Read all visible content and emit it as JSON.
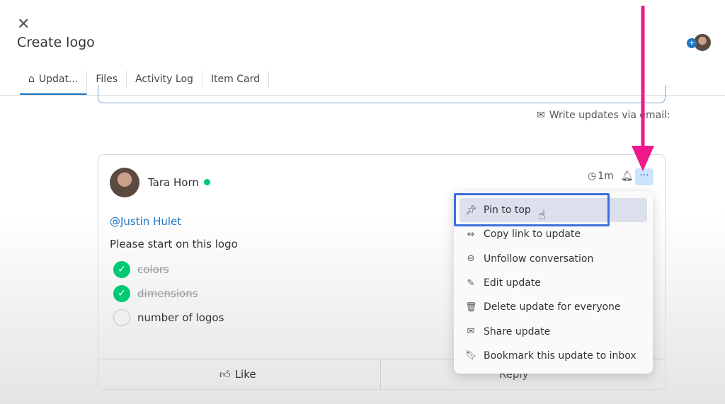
{
  "header": {
    "title": "Create logo",
    "close_icon": "close-icon"
  },
  "tabs": [
    {
      "label": "Updat...",
      "icon": "home-icon"
    },
    {
      "label": "Files"
    },
    {
      "label": "Activity Log"
    },
    {
      "label": "Item Card"
    }
  ],
  "email_link": "Write updates via email:",
  "post": {
    "author": "Tara Horn",
    "time": "1m",
    "mention": "@Justin Hulet",
    "text": "Please start on this logo",
    "checklist": [
      {
        "text": "colors",
        "done": true
      },
      {
        "text": "dimensions",
        "done": true
      },
      {
        "text": "number of logos",
        "done": false
      }
    ],
    "like": "Like",
    "reply": "Reply"
  },
  "menu": [
    {
      "label": "Pin to top",
      "icon": "pin-icon"
    },
    {
      "label": "Copy link to update",
      "icon": "link-icon"
    },
    {
      "label": "Unfollow conversation",
      "icon": "chat-icon"
    },
    {
      "label": "Edit update",
      "icon": "pencil-icon"
    },
    {
      "label": "Delete update for everyone",
      "icon": "trash-icon"
    },
    {
      "label": "Share update",
      "icon": "mail-icon"
    },
    {
      "label": "Bookmark this update to inbox",
      "icon": "bookmark-icon"
    }
  ],
  "colors": {
    "accent": "#1f76c2",
    "online": "#00c875",
    "annotation_arrow": "#f0188a",
    "highlight_box": "#3b6fe0"
  }
}
